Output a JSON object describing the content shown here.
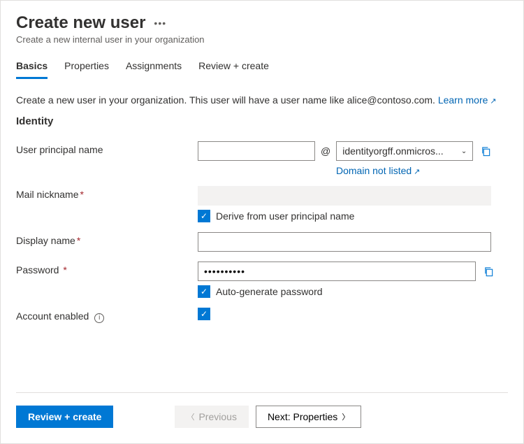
{
  "header": {
    "title": "Create new user",
    "subtitle": "Create a new internal user in your organization"
  },
  "tabs": {
    "basics": "Basics",
    "properties": "Properties",
    "assignments": "Assignments",
    "review": "Review + create"
  },
  "description": {
    "text": "Create a new user in your organization. This user will have a user name like alice@contoso.com. ",
    "learn_more": "Learn more"
  },
  "section": {
    "identity": "Identity"
  },
  "fields": {
    "upn": {
      "label": "User principal name",
      "value": "",
      "at": "@",
      "domain": "identityorgff.onmicros...",
      "domain_not_listed": "Domain not listed"
    },
    "mail_nickname": {
      "label": "Mail nickname",
      "derive_label": "Derive from user principal name"
    },
    "display_name": {
      "label": "Display name",
      "value": ""
    },
    "password": {
      "label": "Password",
      "value": "••••••••••",
      "auto_label": "Auto-generate password"
    },
    "account_enabled": {
      "label": "Account enabled"
    }
  },
  "footer": {
    "review_create": "Review + create",
    "previous": "Previous",
    "next": "Next: Properties"
  }
}
